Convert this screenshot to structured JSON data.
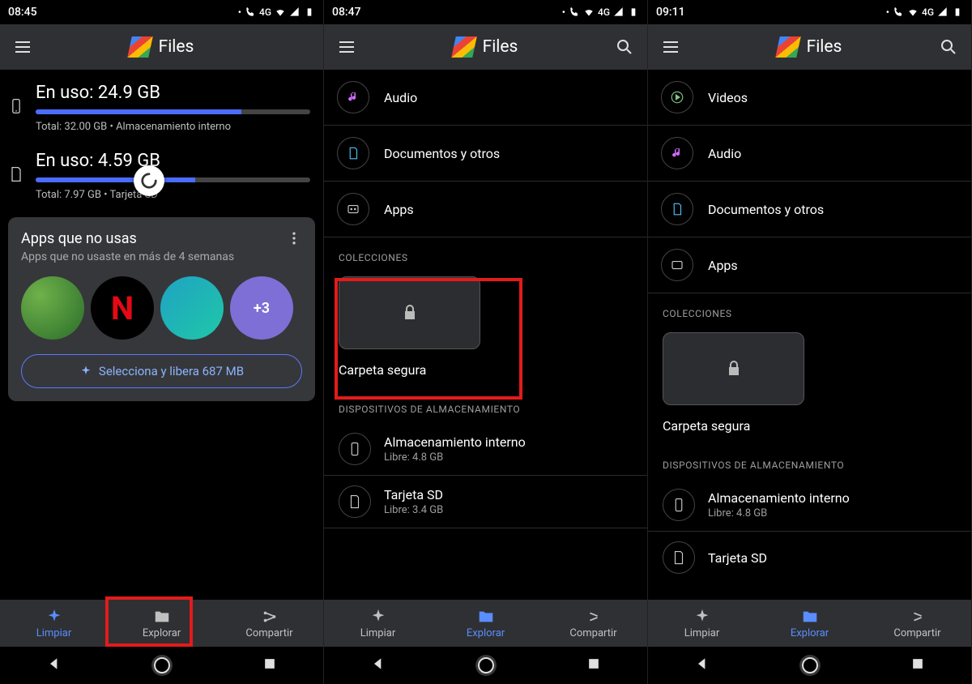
{
  "screens": [
    {
      "time": "08:45",
      "app_title": "Files",
      "storage": [
        {
          "used_label": "En uso: 24.9 GB",
          "pct": 75,
          "total_label": "Total: 32.00 GB • Almacenamiento interno",
          "icon": "phone"
        },
        {
          "used_label": "En uso: 4.59 GB",
          "pct": 58,
          "total_label": "Total: 7.97 GB • Tarjeta SD",
          "icon": "sd"
        }
      ],
      "card": {
        "title": "Apps que no usas",
        "sub": "Apps que no usaste en más de 4 semanas",
        "more_label": "+3",
        "cta": "Selecciona y libera 687 MB"
      },
      "nav": {
        "clean": "Limpiar",
        "explore": "Explorar",
        "share": "Compartir",
        "active": 0
      }
    },
    {
      "time": "08:47",
      "app_title": "Files",
      "categories": [
        {
          "icon": "audio",
          "label": "Audio",
          "color": "#d16bff"
        },
        {
          "icon": "doc",
          "label": "Documentos y otros",
          "color": "#4fc3f7"
        },
        {
          "icon": "apps",
          "label": "Apps",
          "color": "#ccc"
        }
      ],
      "sections": {
        "collections": "COLECCIONES",
        "safe_folder": "Carpeta segura",
        "devices": "DISPOSITIVOS DE ALMACENAMIENTO"
      },
      "devices": [
        {
          "name": "Almacenamiento interno",
          "free": "Libre: 4.8 GB",
          "icon": "phone"
        },
        {
          "name": "Tarjeta SD",
          "free": "Libre: 3.4 GB",
          "icon": "sd"
        }
      ],
      "nav": {
        "clean": "Limpiar",
        "explore": "Explorar",
        "share": "Compartir",
        "active": 1
      }
    },
    {
      "time": "09:11",
      "app_title": "Files",
      "categories": [
        {
          "icon": "video",
          "label": "Videos",
          "color": "#81c784"
        },
        {
          "icon": "audio",
          "label": "Audio",
          "color": "#d16bff"
        },
        {
          "icon": "doc",
          "label": "Documentos y otros",
          "color": "#4fc3f7"
        },
        {
          "icon": "apps",
          "label": "Apps",
          "color": "#ccc"
        }
      ],
      "sections": {
        "collections": "COLECCIONES",
        "safe_folder": "Carpeta segura",
        "devices": "DISPOSITIVOS DE ALMACENAMIENTO"
      },
      "devices": [
        {
          "name": "Almacenamiento interno",
          "free": "Libre: 4.8 GB",
          "icon": "phone"
        },
        {
          "name": "Tarjeta SD",
          "free": "",
          "icon": "sd"
        }
      ],
      "nav": {
        "clean": "Limpiar",
        "explore": "Explorar",
        "share": "Compartir",
        "active": 1
      }
    }
  ],
  "status_indicator": "4G"
}
